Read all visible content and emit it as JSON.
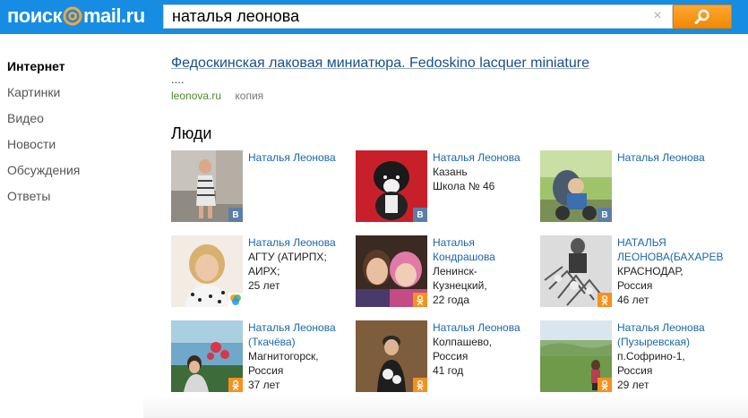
{
  "header": {
    "logo_left": "поиск",
    "logo_right": "mail.ru",
    "query": "наталья леонова",
    "clear_glyph": "×",
    "brand_color": "#168de2",
    "button_color": "#f5911e"
  },
  "sidebar": {
    "items": [
      {
        "label": "Интернет",
        "active": true
      },
      {
        "label": "Картинки"
      },
      {
        "label": "Видео"
      },
      {
        "label": "Новости"
      },
      {
        "label": "Обсуждения"
      },
      {
        "label": "Ответы"
      }
    ]
  },
  "result": {
    "title": "Федоскинская лаковая миниатюра. Fedoskino lacquer miniature",
    "snippet": "....",
    "url": "leonova.ru",
    "copy": "копия"
  },
  "people": {
    "title": "Люди",
    "cards": [
      {
        "name": "Наталья Леонова",
        "lines": [],
        "network": "vk",
        "badge": "В"
      },
      {
        "name": "Наталья Леонова",
        "lines": [
          "Казань",
          "Школа № 46"
        ],
        "network": "vk",
        "badge": "В"
      },
      {
        "name": "Наталья Леонова",
        "lines": [],
        "network": "vk",
        "badge": "В"
      },
      {
        "name": "Наталья Леонова",
        "lines": [
          "АГТУ (АТИРПХ;",
          "АИРХ;",
          "25 лет"
        ],
        "network": "mm",
        "badge": ""
      },
      {
        "name1": "Наталья",
        "name2": "Кондрашова",
        "lines": [
          "Ленинск-",
          "Кузнецкий,",
          "22 года"
        ],
        "network": "ok",
        "badge": "ok"
      },
      {
        "name1": "НАТАЛЬЯ",
        "name2": "ЛЕОНОВА(БАХАРЕВА)",
        "lines": [
          "КРАСНОДАР,",
          "Россия",
          "46 лет"
        ],
        "network": "ok",
        "badge": "ok"
      },
      {
        "name1": "Наталья Леонова",
        "name2": "(Ткачёва)",
        "lines": [
          "Магнитогорск,",
          "Россия",
          "37 лет"
        ],
        "network": "ok",
        "badge": "ok"
      },
      {
        "name": "Наталья Леонова",
        "lines": [
          "Колпашево,",
          "Россия",
          "41 год"
        ],
        "network": "ok",
        "badge": "ok"
      },
      {
        "name1": "Наталья Леонова",
        "name2": "(Пузыревская)",
        "lines": [
          "п.Софрино-1,",
          "Россия",
          "29 лет"
        ],
        "network": "ok",
        "badge": "ok"
      }
    ]
  }
}
